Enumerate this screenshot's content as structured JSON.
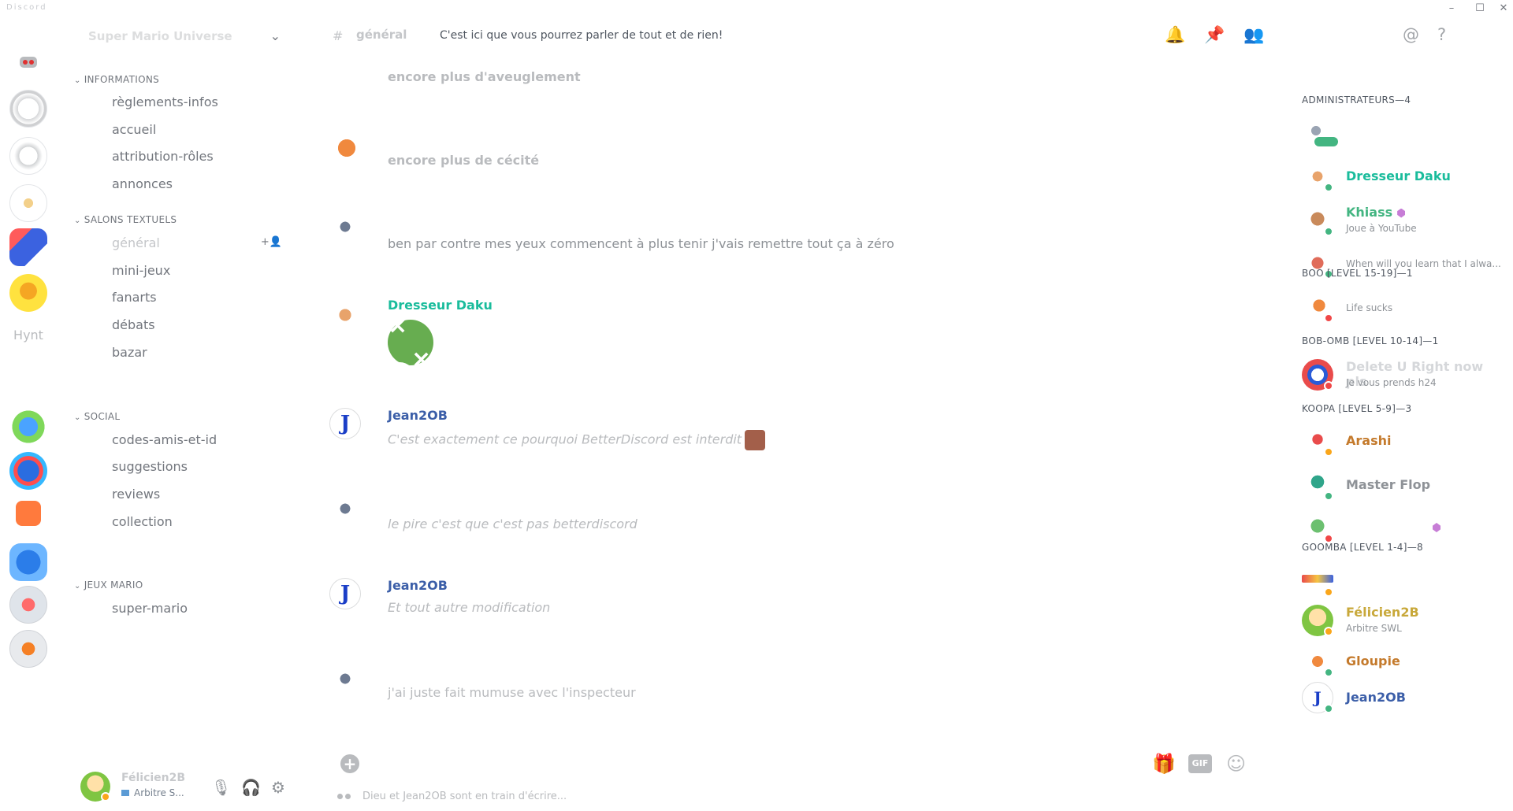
{
  "window": {
    "title": "Discord",
    "controls": {
      "minimize": "–",
      "maximize": "☐",
      "close": "✕"
    }
  },
  "server": {
    "name": "Super Mario Universe",
    "guild_label_hynt": "Hynt"
  },
  "channels": {
    "categories": [
      {
        "name": "INFORMATIONS",
        "items": [
          "règlements-infos",
          "accueil",
          "attribution-rôles",
          "annonces"
        ]
      },
      {
        "name": "SALONS TEXTUELS",
        "items": [
          "général",
          "mini-jeux",
          "fanarts",
          "débats",
          "bazar"
        ]
      },
      {
        "name": "SOCIAL",
        "items": [
          "codes-amis-et-id",
          "suggestions",
          "reviews",
          "collection"
        ]
      },
      {
        "name": "JEUX MARIO",
        "items": [
          "super-mario"
        ]
      }
    ],
    "active": "général"
  },
  "user_panel": {
    "name": "Félicien2B",
    "status_text": "Arbitre S...",
    "icons": [
      "mute-icon",
      "headphones-icon",
      "settings-icon"
    ]
  },
  "chat_header": {
    "channel_name": "général",
    "topic": "C'est ici que vous pourrez parler de tout et de rien!"
  },
  "messages": [
    {
      "author": "",
      "text": "encore plus d'aveuglement"
    },
    {
      "author": "",
      "text": "encore plus de cécité"
    },
    {
      "author": "",
      "text": "ben par contre mes yeux commencent à plus tenir j'vais remettre tout ça à zéro"
    },
    {
      "author": "Dresseur Daku",
      "text": ""
    },
    {
      "author": "Jean2OB",
      "text": "C'est exactement ce pourquoi BetterDiscord est interdit"
    },
    {
      "author": "",
      "text": "le pire c'est que c'est pas betterdiscord"
    },
    {
      "author": "Jean2OB",
      "text": "Et tout autre modification"
    },
    {
      "author": "",
      "text": "j'ai juste fait mumuse avec l'inspecteur"
    }
  ],
  "composer": {
    "gif_label": "GIF",
    "typing": "Dieu et Jean2OB sont en train d'écrire..."
  },
  "members": {
    "groups": [
      {
        "header": "ADMINISTRATEURS—4",
        "members": [
          {
            "name": "",
            "activity": "",
            "color": "#43b581"
          },
          {
            "name": "Dresseur Daku",
            "activity": "",
            "color": "#1abc9c"
          },
          {
            "name": "Khiass",
            "activity": "Joue à YouTube",
            "color": "#43b581"
          },
          {
            "name": "",
            "activity": "When will you learn that I alwa...",
            "color": "#43b581"
          }
        ]
      },
      {
        "header": "BOO [LEVEL 15-19]—1",
        "members": [
          {
            "name": "",
            "activity": "Life sucks",
            "color": "#f04747"
          }
        ]
      },
      {
        "header": "BOB-OMB [LEVEL 10-14]—1",
        "members": [
          {
            "name": "Delete U Right now pls",
            "activity": "Je vous prends h24",
            "color": "#f04747"
          }
        ]
      },
      {
        "header": "KOOPA [LEVEL 5-9]—3",
        "members": [
          {
            "name": "Arashi",
            "activity": "",
            "color": "#faa61a"
          },
          {
            "name": "Master Flop",
            "activity": "",
            "color": "#43b581"
          },
          {
            "name": "",
            "activity": "",
            "color": "#f04747"
          }
        ]
      },
      {
        "header": "GOOMBA [LEVEL 1-4]—8",
        "members": [
          {
            "name": "",
            "activity": "",
            "color": "#faa61a"
          },
          {
            "name": "Félicien2B",
            "activity": "Arbitre SWL",
            "color": "#faa61a"
          },
          {
            "name": "Gloupie",
            "activity": "",
            "color": "#43b581"
          },
          {
            "name": "Jean2OB",
            "activity": "",
            "color": "#43b581"
          }
        ]
      }
    ]
  }
}
